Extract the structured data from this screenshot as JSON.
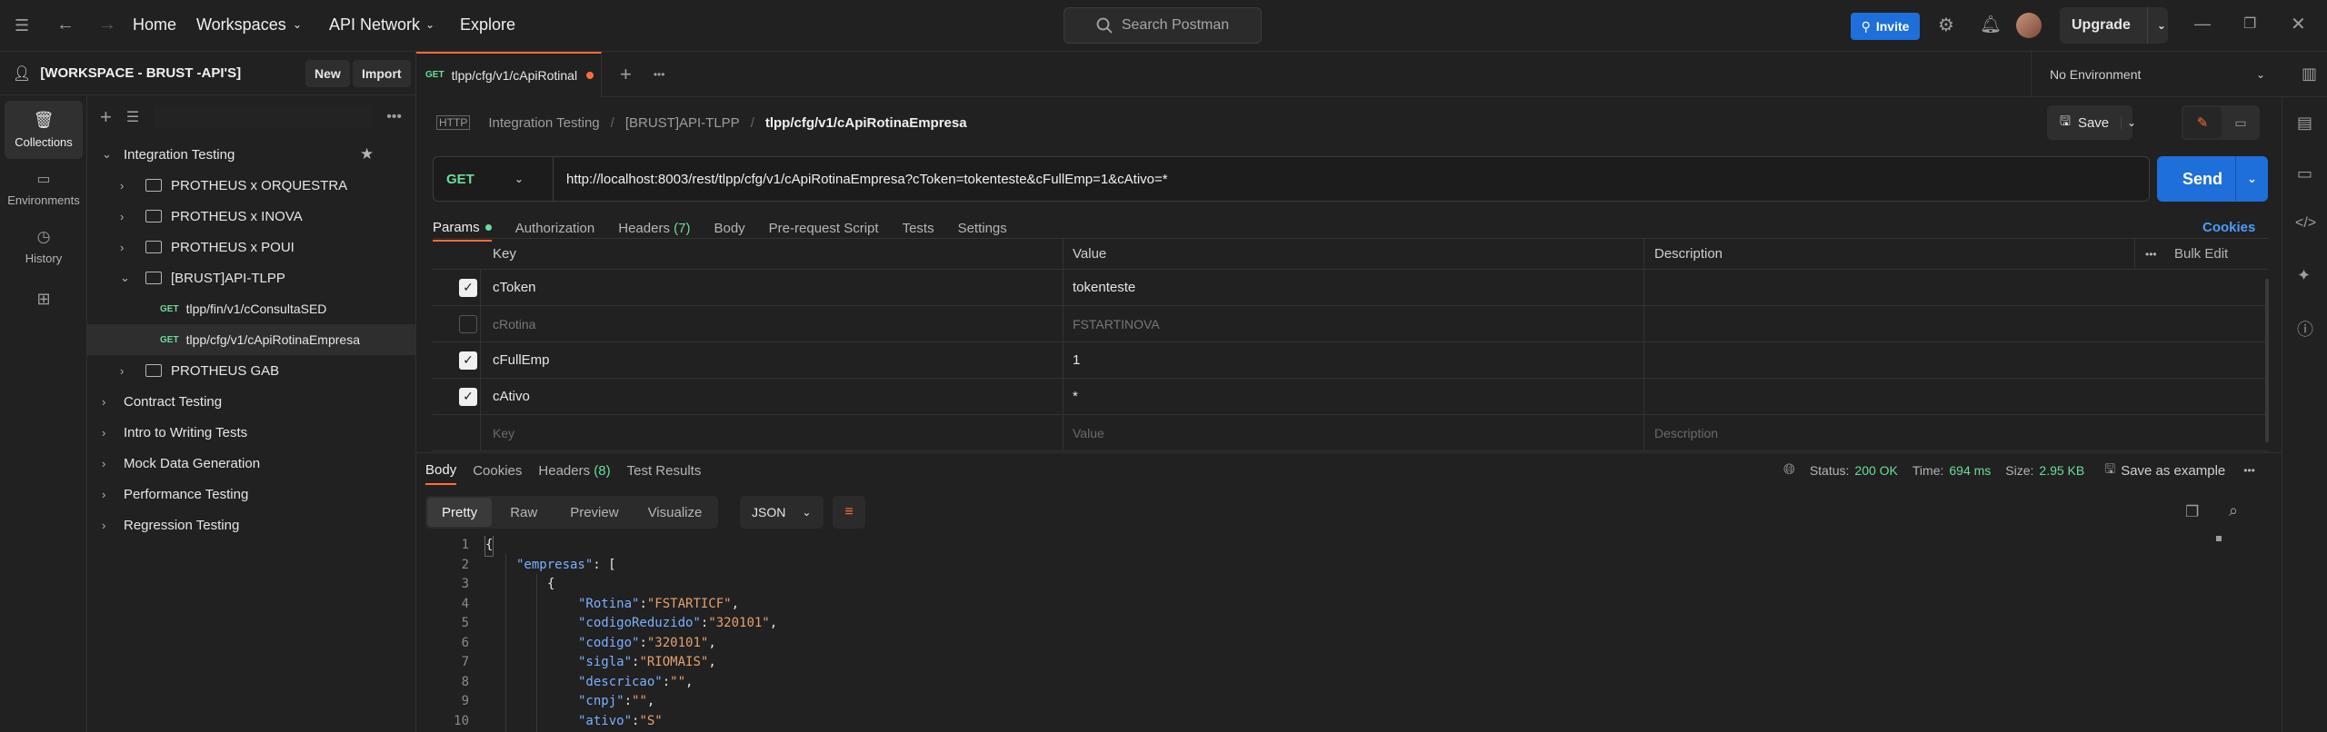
{
  "topbar": {
    "nav": [
      "Home",
      "Workspaces",
      "API Network",
      "Explore"
    ],
    "search_placeholder": "Search Postman",
    "invite_label": "Invite",
    "upgrade_label": "Upgrade"
  },
  "workspace": {
    "name": "[WORKSPACE - BRUST -API'S]",
    "new_label": "New",
    "import_label": "Import"
  },
  "rail": {
    "items": [
      {
        "label": "Collections",
        "icon": "collections-icon"
      },
      {
        "label": "Environments",
        "icon": "environments-icon"
      },
      {
        "label": "History",
        "icon": "history-icon"
      }
    ]
  },
  "sidebar": {
    "tree": [
      {
        "label": "Integration Testing"
      },
      {
        "label": "PROTHEUS x ORQUESTRA"
      },
      {
        "label": "PROTHEUS x INOVA"
      },
      {
        "label": "PROTHEUS x POUI"
      },
      {
        "label": "[BRUST]API-TLPP"
      },
      {
        "label": "tlpp/fin/v1/cConsultaSED",
        "method": "GET"
      },
      {
        "label": "tlpp/cfg/v1/cApiRotinaEmpresa",
        "method": "GET"
      },
      {
        "label": "PROTHEUS GAB"
      },
      {
        "label": "Contract Testing"
      },
      {
        "label": "Intro to Writing Tests"
      },
      {
        "label": "Mock Data Generation"
      },
      {
        "label": "Performance Testing"
      },
      {
        "label": "Regression Testing"
      }
    ]
  },
  "tab": {
    "method": "GET",
    "label": "tlpp/cfg/v1/cApiRotinal"
  },
  "environment": "No Environment",
  "breadcrumb": [
    "Integration Testing",
    "[BRUST]API-TLPP",
    "tlpp/cfg/v1/cApiRotinaEmpresa"
  ],
  "save_label": "Save",
  "request": {
    "method": "GET",
    "url": "http://localhost:8003/rest/tlpp/cfg/v1/cApiRotinaEmpresa?cToken=tokenteste&cFullEmp=1&cAtivo=*",
    "send_label": "Send"
  },
  "req_tabs": [
    "Params",
    "Authorization",
    "Headers",
    "(7)",
    "Body",
    "Pre-request Script",
    "Tests",
    "Settings"
  ],
  "cookies_label": "Cookies",
  "params": {
    "headers": [
      "Key",
      "Value",
      "Description"
    ],
    "bulk_edit": "Bulk Edit",
    "rows": [
      {
        "key": "cToken",
        "value": "tokenteste",
        "checked": true
      },
      {
        "key": "cRotina",
        "value": "FSTARTINOVA",
        "checked": false
      },
      {
        "key": "cFullEmp",
        "value": "1",
        "checked": true
      },
      {
        "key": "cAtivo",
        "value": "*",
        "checked": true
      }
    ],
    "placeholder": {
      "key": "Key",
      "value": "Value",
      "description": "Description"
    }
  },
  "response": {
    "tabs": [
      "Body",
      "Cookies",
      "Headers",
      "(8)",
      "Test Results"
    ],
    "status_label": "Status:",
    "status": "200 OK",
    "time_label": "Time:",
    "time": "694 ms",
    "size_label": "Size:",
    "size": "2.95 KB",
    "save_example": "Save as example",
    "views": [
      "Pretty",
      "Raw",
      "Preview",
      "Visualize"
    ],
    "format": "JSON"
  },
  "code_lines": [
    {
      "n": "1",
      "text": "{"
    },
    {
      "n": "2",
      "key": "\"empresas\"",
      "rest": ": ["
    },
    {
      "n": "3",
      "text": "{"
    },
    {
      "n": "4",
      "key": "\"Rotina\"",
      "val": "\"FSTARTICF\"",
      "end": ","
    },
    {
      "n": "5",
      "key": "\"codigoReduzido\"",
      "val": "\"320101\"",
      "end": ","
    },
    {
      "n": "6",
      "key": "\"codigo\"",
      "val": "\"320101\"",
      "end": ","
    },
    {
      "n": "7",
      "key": "\"sigla\"",
      "val": "\"RIOMAIS\"",
      "end": ","
    },
    {
      "n": "8",
      "key": "\"descricao\"",
      "val": "\"\"",
      "end": ","
    },
    {
      "n": "9",
      "key": "\"cnpj\"",
      "val": "\"\"",
      "end": ","
    },
    {
      "n": "10",
      "key": "\"ativo\"",
      "val": "\"S\"",
      "end": ""
    }
  ],
  "colors": {
    "accent": "#ff6c37",
    "primary": "#1e6fd9",
    "success": "#6bdd9a"
  }
}
